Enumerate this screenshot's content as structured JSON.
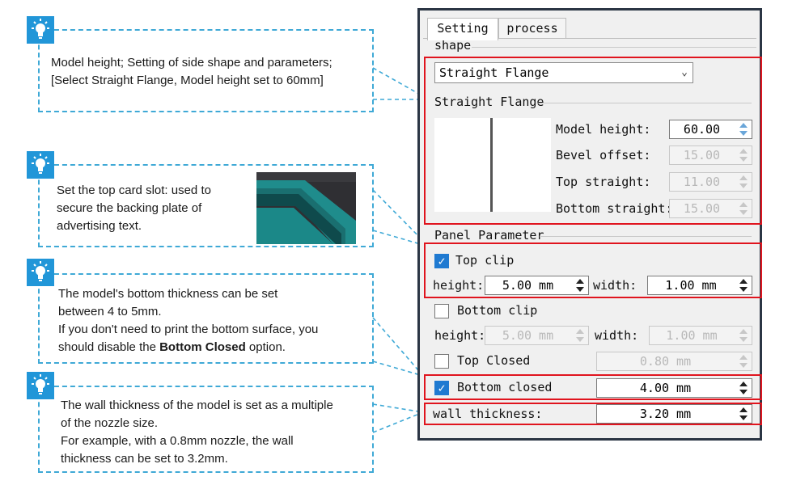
{
  "annotations": [
    {
      "icon": "lightbulb-icon",
      "lines": [
        "Model height; Setting of side shape and parameters;",
        "[Select Straight Flange, Model height set to 60mm]"
      ]
    },
    {
      "icon": "lightbulb-icon",
      "lines": [
        "Set the top card slot: used to",
        "secure the  backing plate of",
        "advertising text."
      ]
    },
    {
      "icon": "lightbulb-icon",
      "line1": "The model's bottom thickness can be set",
      "line2": "between 4 to 5mm.",
      "line3": "If you don't need to print the bottom surface, you",
      "line4_pre": "should disable the ",
      "line4_bold": "Bottom Closed",
      "line4_post": " option."
    },
    {
      "icon": "lightbulb-icon",
      "lines": [
        "The wall thickness of the model is set as a multiple",
        "of the nozzle size.",
        "For example, with a 0.8mm nozzle, the wall",
        "thickness can be set to 3.2mm."
      ]
    }
  ],
  "panel": {
    "tabs": [
      "Setting",
      "process"
    ],
    "shape_group": "shape",
    "shape_select": "Straight Flange",
    "flange_group": "Straight Flange",
    "model_height_label": "Model height:",
    "model_height": "60.00",
    "bevel_offset_label": "Bevel offset:",
    "bevel_offset": "15.00",
    "top_straight_label": "Top straight:",
    "top_straight": "11.00",
    "bottom_straight_label": "Bottom straight:",
    "bottom_straight": "15.00",
    "panel_group": "Panel Parameter",
    "top_clip_label": "Top clip",
    "top_clip_checked": true,
    "top_height_label": "height:",
    "top_height": "5.00 mm",
    "top_width_label": "width:",
    "top_width": "1.00 mm",
    "bottom_clip_label": "Bottom clip",
    "bottom_clip_checked": false,
    "bottom_height_label": "height:",
    "bottom_height": "5.00 mm",
    "bottom_width_label": "width:",
    "bottom_width": "1.00 mm",
    "top_closed_label": "Top Closed",
    "top_closed_checked": false,
    "top_closed_value": "0.80 mm",
    "bottom_closed_label": "Bottom closed",
    "bottom_closed_checked": true,
    "bottom_closed_value": "4.00 mm",
    "wall_thickness_label": "wall thickness:",
    "wall_thickness": "3.20 mm"
  },
  "colors": {
    "annotation_border": "#3fa9d6",
    "icon_bg": "#2196d8",
    "highlight": "#e0141e",
    "panel_border": "#2b3544"
  }
}
